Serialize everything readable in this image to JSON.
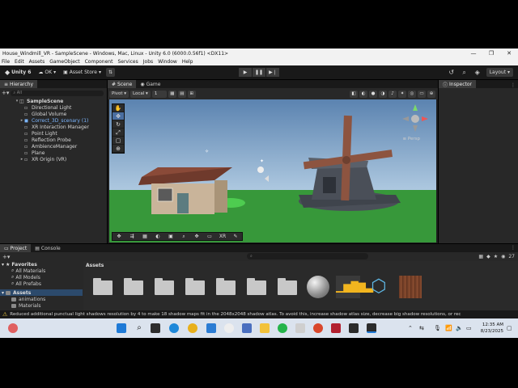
{
  "window": {
    "title": "House_Windmill_VR - SampleScene - Windows, Mac, Linux - Unity 6.0 (6000.0.56f1) <DX11>",
    "controls": [
      "—",
      "❐",
      "✕"
    ]
  },
  "menu": [
    "File",
    "Edit",
    "Assets",
    "GameObject",
    "Component",
    "Services",
    "Jobs",
    "Window",
    "Help"
  ],
  "toolbar": {
    "unity_label": "Unity 6",
    "account_label": "OK",
    "asset_store_label": "Asset Store",
    "layout_label": "Layout"
  },
  "hierarchy": {
    "tab_label": "Hierarchy",
    "search_placeholder": "All",
    "scene_name": "SampleScene",
    "items": [
      {
        "label": "Directional Light"
      },
      {
        "label": "Global Volume"
      },
      {
        "label": "Correct_3D_scenary (1)"
      },
      {
        "label": "XR Interaction Manager"
      },
      {
        "label": "Point Light"
      },
      {
        "label": "Reflection Probe"
      },
      {
        "label": "AmbienceManager"
      },
      {
        "label": "Plane"
      },
      {
        "label": "XR Origin (VR)"
      }
    ]
  },
  "scene_view": {
    "tabs": [
      "Scene",
      "Game"
    ],
    "pivot_label": "Pivot",
    "local_label": "Local",
    "snap_value": "1",
    "persp_label": "Persp",
    "overlay_xr": "XR"
  },
  "inspector": {
    "tab_label": "Inspector"
  },
  "project": {
    "tabs": [
      "Project",
      "Console"
    ],
    "count_badge": "27",
    "tree": {
      "favorites_label": "Favorites",
      "favorites": [
        "All Materials",
        "All Models",
        "All Prefabs"
      ],
      "assets_label": "Assets",
      "assets_children": [
        "animations",
        "Materials"
      ]
    },
    "assets_header": "Assets"
  },
  "console_message": "Reduced additional punctual light shadows resolution by 4 to make 18 shadow maps fit in the 2048x2048 shadow atlas. To avoid this, increase shadow atlas size, decrease big shadow resolutions, or rec",
  "taskbar": {
    "time": "12:35 AM",
    "date": "8/23/2025"
  },
  "colors": {
    "sky_top": "#5e86b2",
    "sky_bottom": "#a9c6e0",
    "ground": "#3fa33f",
    "roof": "#8a4a38",
    "wall": "#c9b49a",
    "windmill": "#4a4f58",
    "blade": "#8d5440",
    "accent_blue": "#4a6ea0"
  }
}
